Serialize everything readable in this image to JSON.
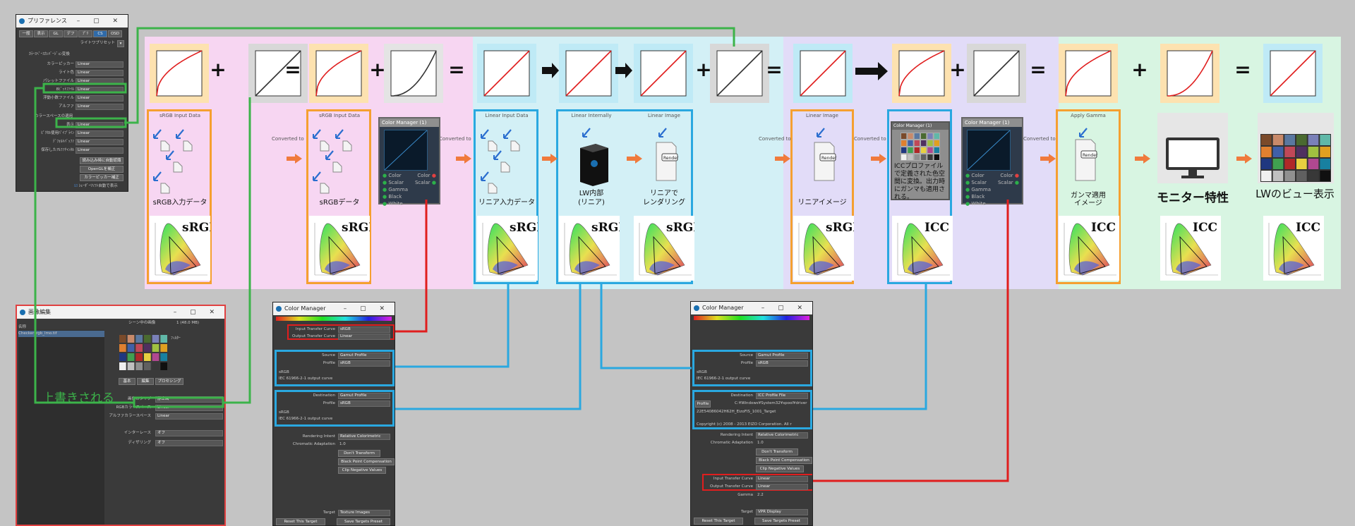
{
  "diagram": {
    "stage_labels": [
      "sRGB Input Data",
      "sRGB Input Data",
      "Linear Input Data",
      "Linear Internally",
      "Linear Image",
      "Linear Image",
      "Apply Gamma"
    ],
    "converted_to": "Converted to",
    "node_texts": {
      "srgb_input": "sRGB入力データ",
      "srgb_data": "sRGBデータ",
      "linear_input": "リニア入力データ",
      "lw_internal_1": "LW内部",
      "lw_internal_2": "(リニア)",
      "linear_render_1": "リニアで",
      "linear_render_2": "レンダリング",
      "linear_image": "リニアイメージ",
      "icc_note": "ICCプロファイルで定義された色空間に変換。出力時にガンマも適用される。",
      "apply_gamma_1": "ガンマ適用",
      "apply_gamma_2": "イメージ",
      "monitor": "モニター特性",
      "lw_view": "LWのビュー表示",
      "render_tag": "Render"
    },
    "gamut_labels": [
      "sRGB",
      "sRGB",
      "sRGB",
      "sRGB",
      "sRGB",
      "sRGB",
      "ICC",
      "ICC",
      "ICC",
      "ICC"
    ],
    "operators": [
      "+",
      "=",
      "+",
      "=",
      "+",
      "=",
      "+",
      "=",
      "+",
      "="
    ],
    "overwritten": "上書きされる",
    "node_title": "Color Manager (1)",
    "node_pins_left": [
      "Color",
      "Scalar",
      "Gamma",
      "Black",
      "White"
    ],
    "node_pins_right": [
      "Color",
      "Scalar"
    ],
    "colors": {
      "green": "#3cb34a",
      "red": "#e01e1e",
      "blue": "#2aa8e0",
      "orange": "#f5a030",
      "pink": "#f7d6f2",
      "cyan": "#d3f0f6",
      "lavender": "#e2dcf8",
      "mint": "#d8f5e2",
      "curve_red": "#e01e1e"
    }
  },
  "prefs_window": {
    "title": "プリファレンス",
    "tabs": [
      "一般",
      "表示",
      "GL",
      "デフ",
      "ﾌﾟﾘ",
      "CS",
      "OSD"
    ],
    "preset_label": "ライトワプリセット",
    "section1": "ｶﾗｰｽﾍﾟｰｽｶﾝﾊﾞｰｼﾞｮﾝ変換",
    "rows": [
      {
        "label": "カラーピッカー",
        "value": "Linear"
      },
      {
        "label": "ライト色",
        "value": "Linear"
      },
      {
        "label": "パレットファイル",
        "value": "Linear"
      },
      {
        "label": "8ﾋﾞｯﾄﾌｧｲﾙ",
        "value": "Linear"
      },
      {
        "label": "浮動小数ファイル",
        "value": "Linear"
      },
      {
        "label": "アルファ",
        "value": "Linear"
      }
    ],
    "section2": "カラースペースの適用",
    "rows2": [
      {
        "label": "表示",
        "value": "Linear"
      },
      {
        "label": "ﾋﾟｸｾﾙ使用ﾊﾟｲﾌﾟﾗｲﾝ",
        "value": "Linear"
      },
      {
        "label": "ﾃﾞﾌｫﾙﾄﾊﾞｯﾌｧ",
        "value": "Linear"
      },
      {
        "label": "保存したｱﾙﾌｧﾁｬﾝﾈﾙ",
        "value": "Linear"
      }
    ],
    "buttons": [
      "読み込み時に自動認識",
      "OpenGLを補正",
      "カラーピッカー補正"
    ],
    "checkbox": "ｼｪｰﾀﾞｰﾘｿﾌﾄ自動で表示"
  },
  "image_editor": {
    "title": "画像編集",
    "name_header": "名称",
    "file": "Checker_rgb_lmo.tif",
    "scene_label": "シーン中の画像",
    "size": "1 (48.0 MB)",
    "filter_label": "ﾌｨﾙﾀｰ",
    "tabs": [
      "基本",
      "編集",
      "プロセシング"
    ],
    "rows": [
      {
        "label": "画像のタイプ",
        "value": "静止画"
      },
      {
        "label": "RGBカラースペース",
        "value": "Linear"
      },
      {
        "label": "アルファカラースペース",
        "value": "Linear"
      },
      {
        "label": "インターレース",
        "value": "オフ"
      },
      {
        "label": "ディザリング",
        "value": "オフ"
      }
    ]
  },
  "cm_left": {
    "title": "Color Manager",
    "input_tc": "Input Transfer Curve",
    "input_tc_v": "sRGB",
    "output_tc": "Output Transfer Curve",
    "output_tc_v": "Linear",
    "source": "Source",
    "source_v": "Gamut Profile",
    "profile": "Profile",
    "profile_v": "sRGB",
    "desc1": "sRGB",
    "desc2": "IEC 61966-2-1 output curve",
    "destination": "Destination",
    "destination_v": "Gamut Profile",
    "dprofile_v": "sRGB",
    "rendering": "Rendering Intent",
    "rendering_v": "Relative Colorimetric",
    "chromatic": "Chromatic Adaptation",
    "chromatic_v": "1.0",
    "dont": "Don't Transform",
    "bpc": "Black Point Compensation",
    "clip": "Clip Negative Values",
    "target": "Target",
    "target_v": "Texture Images",
    "reset": "Reset This Target",
    "save": "Save Targets Preset"
  },
  "cm_right": {
    "title": "Color Manager",
    "source": "Source",
    "source_v": "Gamut Profile",
    "profile": "Profile",
    "profile_v": "sRGB",
    "desc1": "sRGB",
    "desc2": "IEC 61966-2-1 output curve",
    "destination": "Destination",
    "destination_v": "ICC Profile File",
    "dprofile": "Profile",
    "dprofile_v": "C:¥Windows¥System32¥spool¥driver",
    "icc_name": "22E54086042H62H_EizoFlS_1001_Target",
    "copyright": "Copyright (c) 2008 - 2013 EIZO Corporation. All r",
    "rendering": "Rendering Intent",
    "rendering_v": "Relative Colorimetric",
    "chromatic": "Chromatic Adaptation",
    "chromatic_v": "1.0",
    "dont": "Don't Transform",
    "bpc": "Black Point Compensation",
    "clip": "Clip Negative Values",
    "input_tc": "Input Transfer Curve",
    "input_tc_v": "Linear",
    "output_tc": "Output Transfer Curve",
    "output_tc_v": "Linear",
    "gamma": "Gamma",
    "gamma_v": "2.2",
    "target": "Target",
    "target_v": "VPR Display",
    "reset": "Reset This Target",
    "save": "Save Targets Preset"
  }
}
